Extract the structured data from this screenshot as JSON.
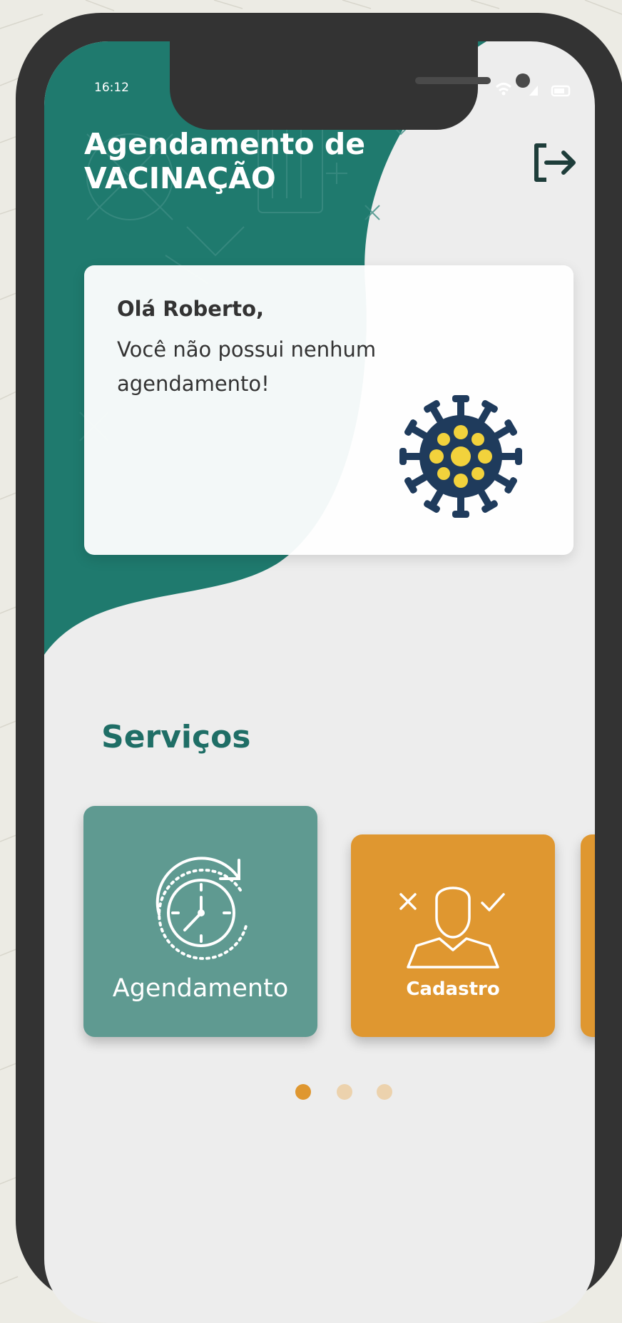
{
  "status_bar": {
    "time": "16:12"
  },
  "header": {
    "title_line1": "Agendamento de",
    "title_line2": "VACINAÇÃO",
    "logout_icon": "logout-icon"
  },
  "notice_card": {
    "greeting": "Olá Roberto,",
    "message": "Você não possui nenhum agendamento!",
    "illustration": "virus-icon"
  },
  "services": {
    "title": "Serviços",
    "items": [
      {
        "label": "Agendamento",
        "icon": "clock-refresh-icon",
        "color": "#5f9a91"
      },
      {
        "label": "Cadastro",
        "icon": "user-check-icon",
        "color": "#df9730"
      }
    ]
  },
  "pagination": {
    "total": 3,
    "active": 1
  },
  "colors": {
    "primary": "#1f7a6e",
    "accent": "#df9730",
    "background": "#ededed",
    "phone_frame": "#333333"
  }
}
